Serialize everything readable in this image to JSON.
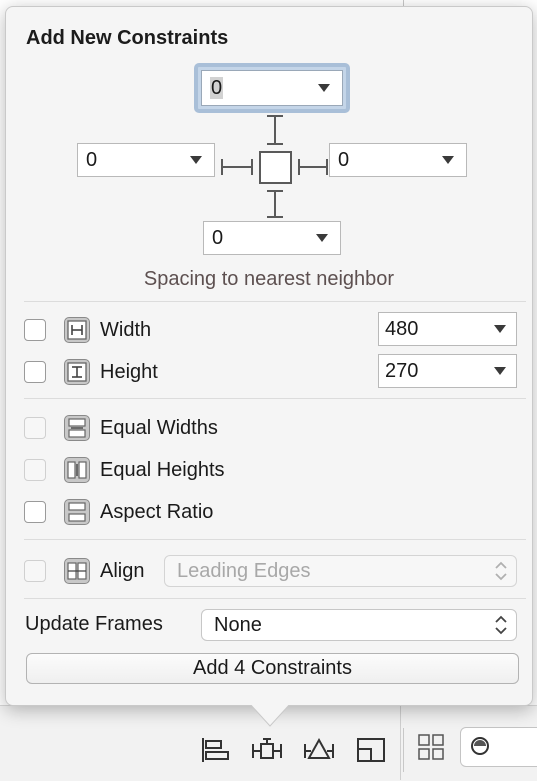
{
  "popover": {
    "title": "Add New Constraints",
    "spacing": {
      "top": "0",
      "left": "0",
      "right": "0",
      "bottom": "0",
      "caption": "Spacing to nearest neighbor"
    },
    "size_rows": [
      {
        "label": "Width",
        "value": "480",
        "checked": false,
        "icon": "width-constraint-icon"
      },
      {
        "label": "Height",
        "value": "270",
        "checked": false,
        "icon": "height-constraint-icon"
      }
    ],
    "equal_rows": [
      {
        "label": "Equal Widths",
        "enabled": false,
        "icon": "equal-widths-icon"
      },
      {
        "label": "Equal Heights",
        "enabled": false,
        "icon": "equal-heights-icon"
      },
      {
        "label": "Aspect Ratio",
        "enabled": true,
        "icon": "aspect-ratio-icon"
      }
    ],
    "align": {
      "label": "Align",
      "value": "Leading Edges",
      "enabled": false
    },
    "update_frames": {
      "label": "Update Frames",
      "value": "None"
    },
    "add_button": "Add 4 Constraints"
  },
  "toolbar": {
    "icons": [
      "align-icon",
      "pin-icon",
      "resolve-auto-layout-issues-icon",
      "resizing-behavior-icon",
      "grid-icon",
      "filter-icon"
    ]
  },
  "colors": {
    "popover_bg": "#f5f5f5",
    "focus_ring": "#a9bfd8",
    "caption_text": "#5d5050"
  }
}
